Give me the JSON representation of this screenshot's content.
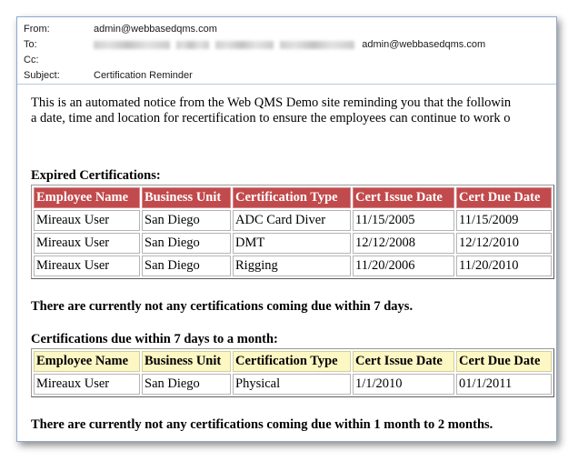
{
  "email": {
    "from_label": "From:",
    "from_value": "admin@webbasedqms.com",
    "to_label": "To:",
    "to_value": "admin@webbasedqms.com",
    "cc_label": "Cc:",
    "subject_label": "Subject:",
    "subject_value": "Certification Reminder"
  },
  "content": {
    "intro_line1": "This is an automated notice from the Web QMS Demo site reminding you that the followin",
    "intro_line2": "a date, time and location for recertification to ensure the employees can continue to work o",
    "expired_title": "Expired Certifications:",
    "notice_7days": "There are currently not any certifications coming due within 7 days.",
    "month_title": "Certifications due within 7 days to a month:",
    "notice_2months": "There are currently not any certifications coming due within 1 month to 2 months."
  },
  "columns": [
    "Employee Name",
    "Business Unit",
    "Certification Type",
    "Cert Issue Date",
    "Cert Due Date"
  ],
  "expired_rows": [
    [
      "Mireaux User",
      "San Diego",
      "ADC Card Diver",
      "11/15/2005",
      "11/15/2009"
    ],
    [
      "Mireaux User",
      "San Diego",
      "DMT",
      "12/12/2008",
      "12/12/2010"
    ],
    [
      "Mireaux User",
      "San Diego",
      "Rigging",
      "11/20/2006",
      "11/20/2010"
    ]
  ],
  "month_rows": [
    [
      "Mireaux User",
      "San Diego",
      "Physical",
      "1/1/2010",
      "01/1/2011"
    ]
  ],
  "colors": {
    "expired_header": "#c14a4c",
    "soon_header": "#fdf7c4",
    "frame_border": "#8fa9cf"
  }
}
